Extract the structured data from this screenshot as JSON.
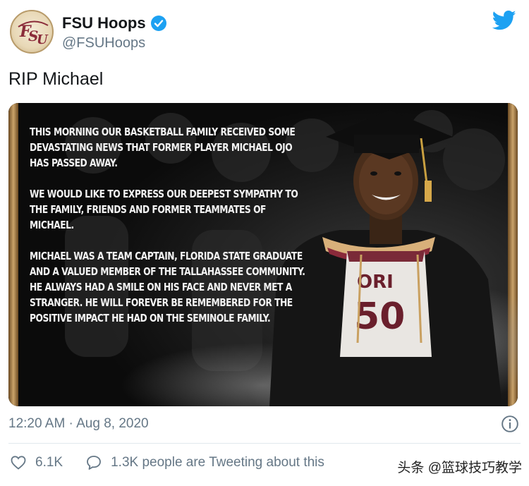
{
  "account": {
    "display_name": "FSU Hoops",
    "handle": "@FSUHoops",
    "avatar_icon": "fsu-logo",
    "verified_icon": "verified-badge-icon"
  },
  "tweet": {
    "text": "RIP Michael",
    "timestamp": "12:20 AM · Aug 8, 2020"
  },
  "media": {
    "paragraphs": [
      "This morning our basketball family received some devastating news that former player Michael Ojo has passed away.",
      "We would like to express our deepest sympathy to the family, friends and former teammates of Michael.",
      "Michael was a team captain, Florida State graduate and a valued member of the Tallahassee community. He always had a smile on his face and never met a stranger. He will forever be remembered for the positive impact he had on the Seminole family."
    ],
    "jersey_text": "ORI",
    "jersey_number": "50"
  },
  "engagement": {
    "likes": "6.1K",
    "discussion": "1.3K people are Tweeting about this"
  },
  "watermark": "头条 @篮球技巧教学",
  "colors": {
    "twitter_blue": "#1da1f2",
    "text_primary": "#14171a",
    "text_secondary": "#657786",
    "fsu_garnet": "#782f40",
    "fsu_gold": "#ceb888"
  }
}
